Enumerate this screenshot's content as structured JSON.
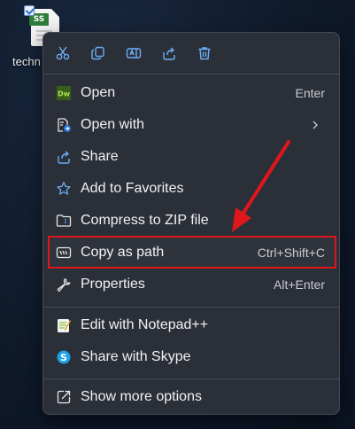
{
  "desktop_file": {
    "badge": "SS",
    "label": "techn"
  },
  "toolbar": [
    {
      "name": "cut-button",
      "icon": "scissors-icon"
    },
    {
      "name": "copy-button",
      "icon": "copy-icon"
    },
    {
      "name": "rename-button",
      "icon": "rename-icon"
    },
    {
      "name": "share-button",
      "icon": "share-icon"
    },
    {
      "name": "delete-button",
      "icon": "trash-icon"
    }
  ],
  "menu": {
    "open": {
      "label": "Open",
      "shortcut": "Enter",
      "icon": "dreamweaver-icon"
    },
    "open_with": {
      "label": "Open with",
      "icon": "open-with-icon"
    },
    "share": {
      "label": "Share",
      "icon": "share-icon"
    },
    "favorites": {
      "label": "Add to Favorites",
      "icon": "star-icon"
    },
    "compress": {
      "label": "Compress to ZIP file",
      "icon": "zip-folder-icon"
    },
    "copy_path": {
      "label": "Copy as path",
      "shortcut": "Ctrl+Shift+C",
      "icon": "path-icon"
    },
    "properties": {
      "label": "Properties",
      "shortcut": "Alt+Enter",
      "icon": "wrench-icon"
    },
    "notepad": {
      "label": "Edit with Notepad++",
      "icon": "notepadpp-icon"
    },
    "skype": {
      "label": "Share with Skype",
      "icon": "skype-icon"
    },
    "more": {
      "label": "Show more options",
      "icon": "more-options-icon"
    }
  },
  "colors": {
    "menu_bg": "#2b2f38",
    "highlight_border": "#e0161d",
    "icon_accent": "#6aaef5"
  }
}
